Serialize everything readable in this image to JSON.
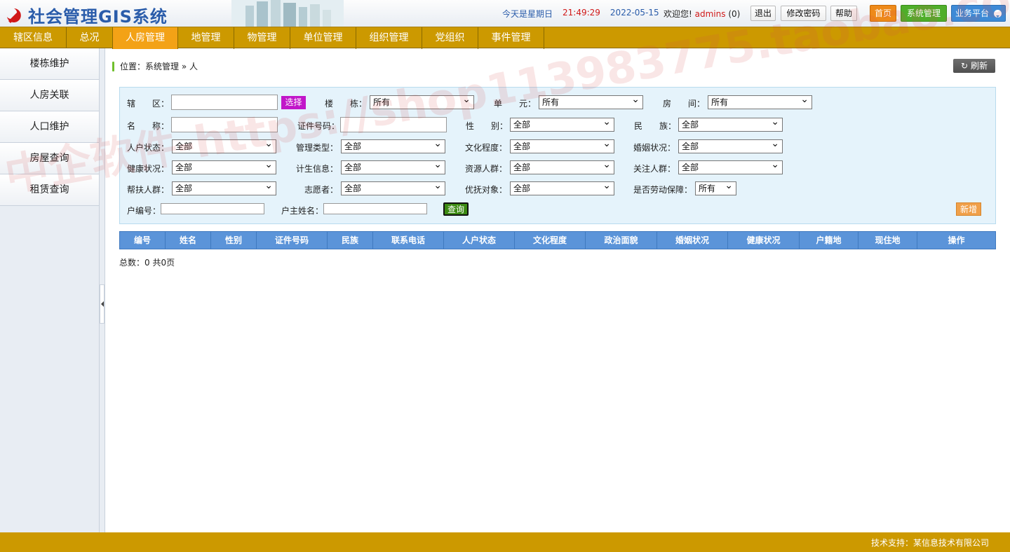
{
  "app": {
    "title": "社会管理GIS系统"
  },
  "header": {
    "weekday": "今天是星期日",
    "time": "21:49:29",
    "date": "2022-05-15",
    "welcome_label": "欢迎您!",
    "username": "admins",
    "message_count": "(0)",
    "logout": "退出",
    "change_password": "修改密码",
    "help": "帮助",
    "home": "首页",
    "system_admin": "系统管理",
    "business_platform": "业务平台"
  },
  "nav": {
    "items": [
      "辖区信息",
      "总况",
      "人房管理",
      "地管理",
      "物管理",
      "单位管理",
      "组织管理",
      "党组织",
      "事件管理"
    ],
    "active_index": 2
  },
  "sidebar": {
    "items": [
      "楼栋维护",
      "人房关联",
      "人口维护",
      "房屋查询",
      "租赁查询"
    ]
  },
  "breadcrumb": "位置：系统管理 » 人",
  "refresh_label": "刷新",
  "filter": {
    "row1": {
      "district_label": "辖　　区：",
      "select_btn": "选择",
      "building_label": "楼　　栋：",
      "building_value": "所有",
      "unit_label": "单　　元：",
      "unit_value": "所有",
      "room_label": "房　　间：",
      "room_value": "所有"
    },
    "row2": {
      "name_label": "名　　称：",
      "id_label": "证件号码：",
      "gender_label": "性　　别：",
      "gender_value": "全部",
      "ethnic_label": "民　　族：",
      "ethnic_value": "全部"
    },
    "row3": [
      {
        "label": "人户状态：",
        "value": "全部"
      },
      {
        "label": "管理类型：",
        "value": "全部"
      },
      {
        "label": "文化程度：",
        "value": "全部"
      },
      {
        "label": "婚姻状况：",
        "value": "全部"
      }
    ],
    "row4": [
      {
        "label": "健康状况：",
        "value": "全部"
      },
      {
        "label": "计生信息：",
        "value": "全部"
      },
      {
        "label": "资源人群：",
        "value": "全部"
      },
      {
        "label": "关注人群：",
        "value": "全部"
      }
    ],
    "row5": [
      {
        "label": "帮扶人群：",
        "value": "全部"
      },
      {
        "label": "志愿者：",
        "value": "全部"
      },
      {
        "label": "优抚对象：",
        "value": "全部"
      },
      {
        "label": "是否劳动保障：",
        "value": "所有"
      }
    ],
    "row6": {
      "household_no_label": "户编号：",
      "owner_name_label": "户主姓名：",
      "query_btn": "查询",
      "add_btn": "新增"
    }
  },
  "table": {
    "columns": [
      "编号",
      "姓名",
      "性别",
      "证件号码",
      "民族",
      "联系电话",
      "人户状态",
      "文化程度",
      "政治面貌",
      "婚姻状况",
      "健康状况",
      "户籍地",
      "现住地",
      "操作"
    ]
  },
  "total_text": "总数：0 共0页",
  "footer": "技术支持：某信息技术有限公司",
  "watermark": "中企软件-https://shop113983775.taobao.com",
  "colors": {
    "nav": "#cc9900",
    "nav_active": "#f3a216",
    "grid_header": "#5b94d9",
    "filter_bg": "#e5f3fb"
  }
}
